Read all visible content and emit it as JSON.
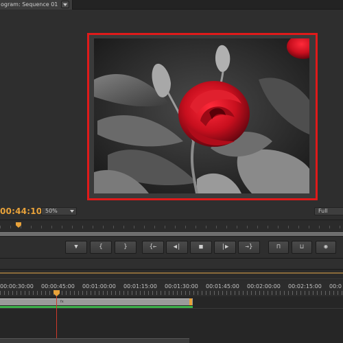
{
  "panel": {
    "tab_label": "ogram: Sequence 01"
  },
  "monitor": {
    "timecode": "00:44:10",
    "zoom": "50%",
    "resolution": "Full"
  },
  "transport": {
    "buttons": [
      {
        "name": "add-marker-button",
        "glyph": "▼"
      },
      {
        "name": "mark-in-button",
        "glyph": "{"
      },
      {
        "name": "mark-out-button",
        "glyph": "}"
      },
      {
        "name": "go-to-in-button",
        "glyph": "{←"
      },
      {
        "name": "step-back-button",
        "glyph": "◀|"
      },
      {
        "name": "stop-button",
        "glyph": "■"
      },
      {
        "name": "step-forward-button",
        "glyph": "|▶"
      },
      {
        "name": "go-to-out-button",
        "glyph": "→}"
      },
      {
        "name": "lift-button",
        "glyph": "⊓"
      },
      {
        "name": "extract-button",
        "glyph": "⊔"
      },
      {
        "name": "export-frame-button",
        "glyph": "◉"
      }
    ]
  },
  "timeline": {
    "ruler_labels": [
      "00:00:30:00",
      "00:00:45:00",
      "00:01:00:00",
      "00:01:15:00",
      "00:01:30:00",
      "00:01:45:00",
      "00:02:00:00",
      "00:02:15:00",
      "00:0"
    ]
  },
  "colors": {
    "accent": "#e8a23a",
    "frame_border": "#e01a1a",
    "render_bar": "#3cb24a"
  }
}
